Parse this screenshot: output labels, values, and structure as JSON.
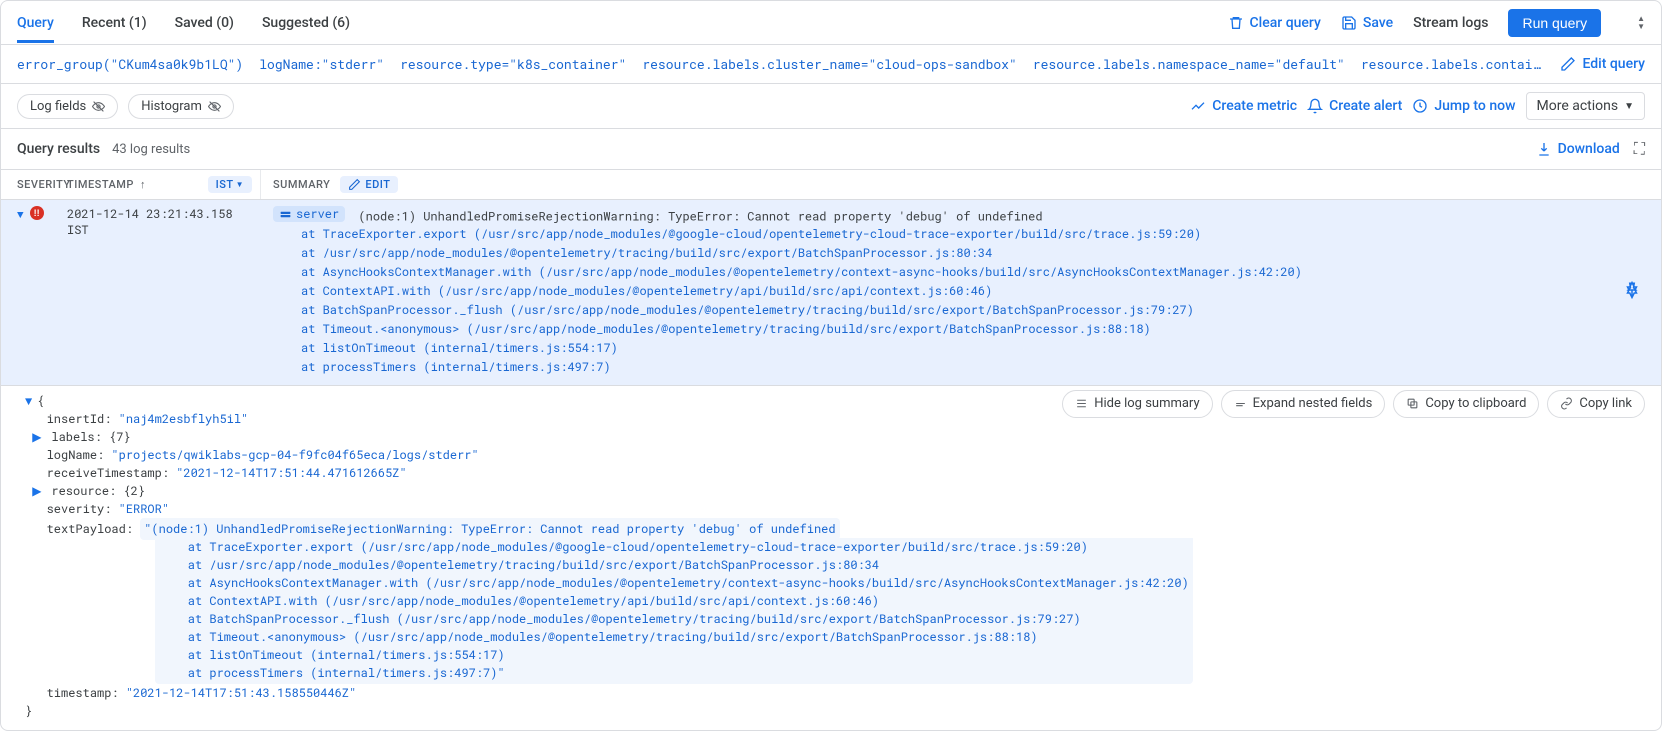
{
  "tabs": [
    {
      "label": "Query",
      "active": true
    },
    {
      "label": "Recent (1)",
      "active": false
    },
    {
      "label": "Saved (0)",
      "active": false
    },
    {
      "label": "Suggested (6)",
      "active": false
    }
  ],
  "actions": {
    "clear_query": "Clear query",
    "save": "Save",
    "stream": "Stream logs",
    "run": "Run query"
  },
  "query_tokens": [
    "error_group(\"CKum4sa0k9b1LQ\")",
    "logName:\"stderr\"",
    "resource.type=\"k8s_container\"",
    "resource.labels.cluster_name=\"cloud-ops-sandbox\"",
    "resource.labels.namespace_name=\"default\"",
    "resource.labels.containe…"
  ],
  "edit_query": "Edit query",
  "toolbar": {
    "log_fields": "Log fields",
    "histogram": "Histogram",
    "create_metric": "Create metric",
    "create_alert": "Create alert",
    "jump_to_now": "Jump to now",
    "more_actions": "More actions"
  },
  "results": {
    "title": "Query results",
    "count": "43 log results",
    "download": "Download"
  },
  "columns": {
    "severity": "SEVERITY",
    "timestamp": "TIMESTAMP",
    "tz": "IST",
    "summary": "SUMMARY",
    "edit": "EDIT"
  },
  "log": {
    "timestamp": "2021-12-14 23:21:43.158 IST",
    "server_chip": "server",
    "message": "(node:1) UnhandledPromiseRejectionWarning: TypeError: Cannot read property 'debug' of undefined",
    "trace": [
      "at TraceExporter.export (/usr/src/app/node_modules/@google-cloud/opentelemetry-cloud-trace-exporter/build/src/trace.js:59:20)",
      "at /usr/src/app/node_modules/@opentelemetry/tracing/build/src/export/BatchSpanProcessor.js:80:34",
      "at AsyncHooksContextManager.with (/usr/src/app/node_modules/@opentelemetry/context-async-hooks/build/src/AsyncHooksContextManager.js:42:20)",
      "at ContextAPI.with (/usr/src/app/node_modules/@opentelemetry/api/build/src/api/context.js:60:46)",
      "at BatchSpanProcessor._flush (/usr/src/app/node_modules/@opentelemetry/tracing/build/src/export/BatchSpanProcessor.js:79:27)",
      "at Timeout.<anonymous> (/usr/src/app/node_modules/@opentelemetry/tracing/build/src/export/BatchSpanProcessor.js:88:18)",
      "at listOnTimeout (internal/timers.js:554:17)",
      "at processTimers (internal/timers.js:497:7)"
    ]
  },
  "json_actions": {
    "hide": "Hide log summary",
    "expand": "Expand nested fields",
    "copy": "Copy to clipboard",
    "link": "Copy link"
  },
  "json": {
    "open": "{",
    "insertId_k": "insertId:",
    "insertId_v": "\"naj4m2esbflyh5il\"",
    "labels_k": "labels:",
    "labels_v": "{7}",
    "logName_k": "logName:",
    "logName_v": "\"projects/qwiklabs-gcp-04-f9fc04f65eca/logs/stderr\"",
    "receiveTimestamp_k": "receiveTimestamp:",
    "receiveTimestamp_v": "\"2021-12-14T17:51:44.471612665Z\"",
    "resource_k": "resource:",
    "resource_v": "{2}",
    "severity_k": "severity:",
    "severity_v": "\"ERROR\"",
    "textPayload_k": "textPayload:",
    "textPayload_head": "\"(node:1) UnhandledPromiseRejectionWarning: TypeError: Cannot read property 'debug' of undefined",
    "textPayload_lines": [
      "    at TraceExporter.export (/usr/src/app/node_modules/@google-cloud/opentelemetry-cloud-trace-exporter/build/src/trace.js:59:20)",
      "    at /usr/src/app/node_modules/@opentelemetry/tracing/build/src/export/BatchSpanProcessor.js:80:34",
      "    at AsyncHooksContextManager.with (/usr/src/app/node_modules/@opentelemetry/context-async-hooks/build/src/AsyncHooksContextManager.js:42:20)",
      "    at ContextAPI.with (/usr/src/app/node_modules/@opentelemetry/api/build/src/api/context.js:60:46)",
      "    at BatchSpanProcessor._flush (/usr/src/app/node_modules/@opentelemetry/tracing/build/src/export/BatchSpanProcessor.js:79:27)",
      "    at Timeout.<anonymous> (/usr/src/app/node_modules/@opentelemetry/tracing/build/src/export/BatchSpanProcessor.js:88:18)",
      "    at listOnTimeout (internal/timers.js:554:17)",
      "    at processTimers (internal/timers.js:497:7)\""
    ],
    "timestamp_k": "timestamp:",
    "timestamp_v": "\"2021-12-14T17:51:43.158550446Z\"",
    "close": "}"
  }
}
